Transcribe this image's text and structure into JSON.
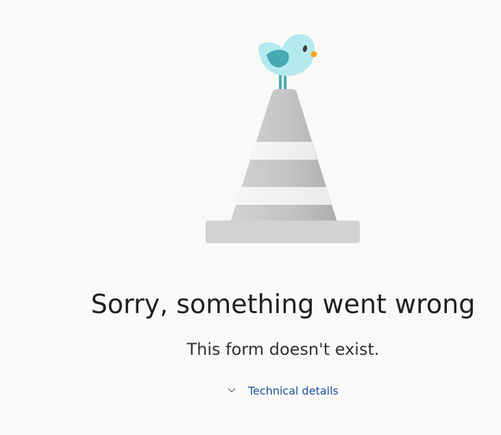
{
  "error": {
    "title": "Sorry, something went wrong",
    "message": "This form doesn't exist."
  },
  "details": {
    "label": "Technical details",
    "expanded": false
  },
  "colors": {
    "background": "#faf9f8",
    "link": "#1b4f99",
    "bird_body": "#b4eaee",
    "bird_wing": "#47aab2",
    "bird_beak": "#f5a623",
    "cone_gray": "#c8c8c8",
    "cone_stripe": "#f3f2f1"
  },
  "icons": {
    "illustration": "bird-on-traffic-cone",
    "toggle": "chevron-down-icon"
  }
}
